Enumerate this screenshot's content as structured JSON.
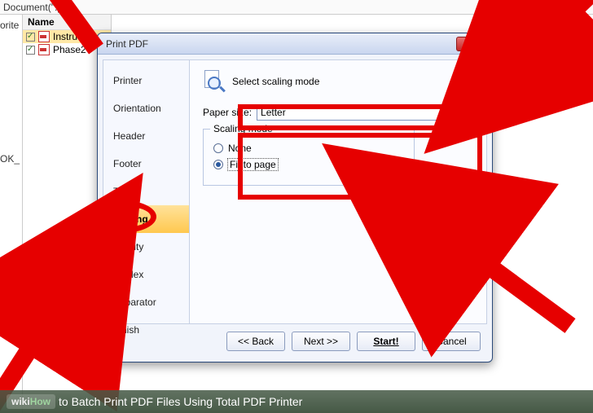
{
  "bg": {
    "pathbar": "Document(\".pdf)",
    "fav_label": "orite",
    "name_header": "Name",
    "files": [
      "Instruc",
      "Phase2"
    ],
    "status": "OK_"
  },
  "dialog": {
    "title": "Print PDF",
    "close_glyph": "✕",
    "sidebar": [
      "Printer",
      "Orientation",
      "Header",
      "Footer",
      "Tray",
      "Scaling",
      "Quality",
      "Duplex",
      "Separator",
      "Finish"
    ],
    "selected_sidebar_index": 5,
    "heading": "Select scaling mode",
    "paper_label": "Paper size:",
    "paper_value": "Letter",
    "group_legend": "Scaling mode",
    "radios": [
      {
        "label": "None",
        "checked": false
      },
      {
        "label": "Fit to page",
        "checked": true
      }
    ],
    "buttons": {
      "back": "<< Back",
      "next": "Next >>",
      "start": "Start!",
      "cancel": "Cancel"
    }
  },
  "caption": {
    "brand1": "wiki",
    "brand2": "How",
    "text": " to Batch Print PDF Files Using Total PDF Printer"
  }
}
